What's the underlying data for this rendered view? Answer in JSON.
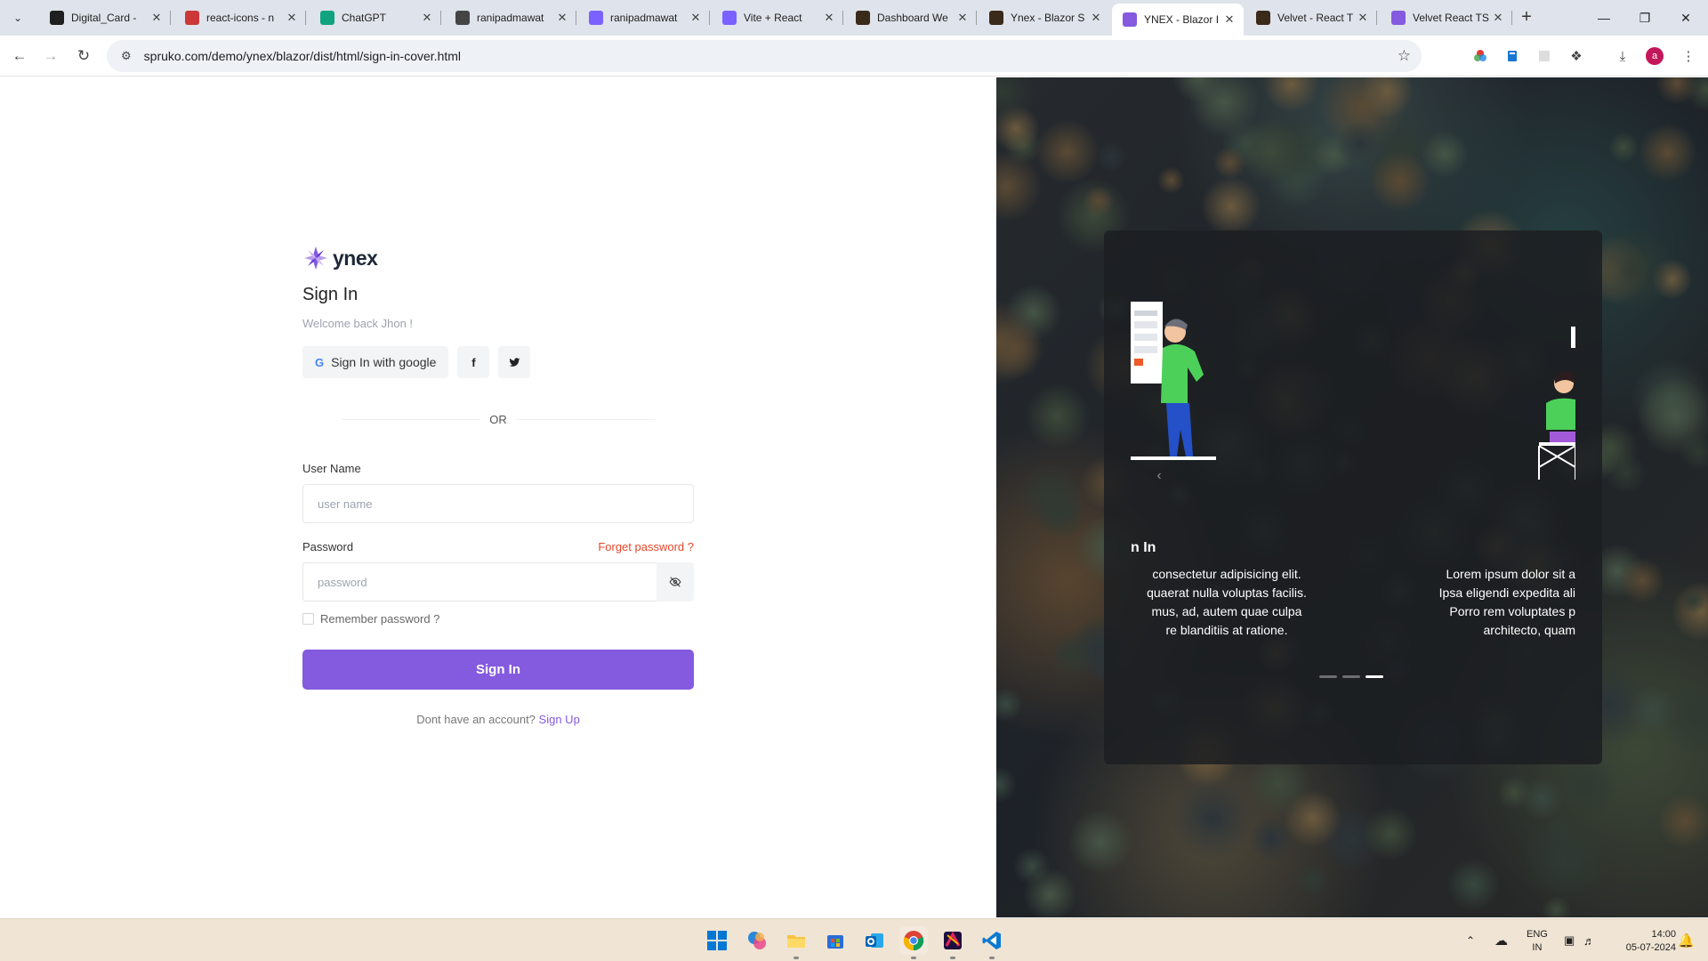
{
  "browser": {
    "tabs": [
      {
        "title": "Digital_Card - ",
        "favicon_color": "#1f1f1f",
        "favicon_glyph": "github-icon"
      },
      {
        "title": "react-icons - n",
        "favicon_color": "#cb3837",
        "favicon_glyph": "npm-icon"
      },
      {
        "title": "ChatGPT",
        "favicon_color": "#10a37f",
        "favicon_glyph": "chatgpt-icon"
      },
      {
        "title": "ranipadmawat",
        "favicon_color": "#444444",
        "favicon_glyph": "github-icon"
      },
      {
        "title": "ranipadmawat",
        "favicon_color": "#7b61ff",
        "favicon_glyph": "vite-icon"
      },
      {
        "title": "Vite + React",
        "favicon_color": "#7b61ff",
        "favicon_glyph": "vite-icon"
      },
      {
        "title": "Dashboard We",
        "favicon_color": "#3a2a1a",
        "favicon_glyph": "themeforest-icon"
      },
      {
        "title": "Ynex - Blazor S",
        "favicon_color": "#3a2a1a",
        "favicon_glyph": "themeforest-icon"
      },
      {
        "title": "YNEX - Blazor I",
        "favicon_color": "#845adf",
        "favicon_glyph": "ynex-icon"
      },
      {
        "title": "Velvet - React T",
        "favicon_color": "#3a2a1a",
        "favicon_glyph": "themeforest-icon"
      },
      {
        "title": "Velvet React TS",
        "favicon_color": "#845adf",
        "favicon_glyph": "velvet-icon"
      }
    ],
    "active_tab_index": 8,
    "url": "spruko.com/demo/ynex/blazor/dist/html/sign-in-cover.html",
    "profile_initial": "a"
  },
  "signin": {
    "brand": "ynex",
    "title": "Sign In",
    "subtitle": "Welcome back Jhon !",
    "google_label": "Sign In with google",
    "google_glyph": "G",
    "facebook_glyph": "f",
    "twitter_glyph": "t",
    "or_text": "OR",
    "username_label": "User Name",
    "username_placeholder": "user name",
    "password_label": "Password",
    "forget_label": "Forget password ?",
    "password_placeholder": "password",
    "remember_label": "Remember password ?",
    "submit_label": "Sign In",
    "signup_prompt": "Dont have an account?",
    "signup_link": "Sign Up",
    "accent_color": "#845adf",
    "danger_color": "#e5472a"
  },
  "carousel": {
    "slide_title": "n In",
    "slide_text_left": "consectetur adipisicing elit.\nquaerat nulla voluptas facilis.\nmus, ad, autem quae culpa\nre blanditiis at ratione.",
    "slide_text_right": "Lorem ipsum dolor sit a\nIpsa eligendi expedita ali\nPorro rem voluptates p\narchitecto, quam",
    "indicator_count": 3,
    "active_indicator": 2
  },
  "taskbar": {
    "language_line1": "ENG",
    "language_line2": "IN",
    "time": "14:00",
    "date": "05-07-2024"
  }
}
